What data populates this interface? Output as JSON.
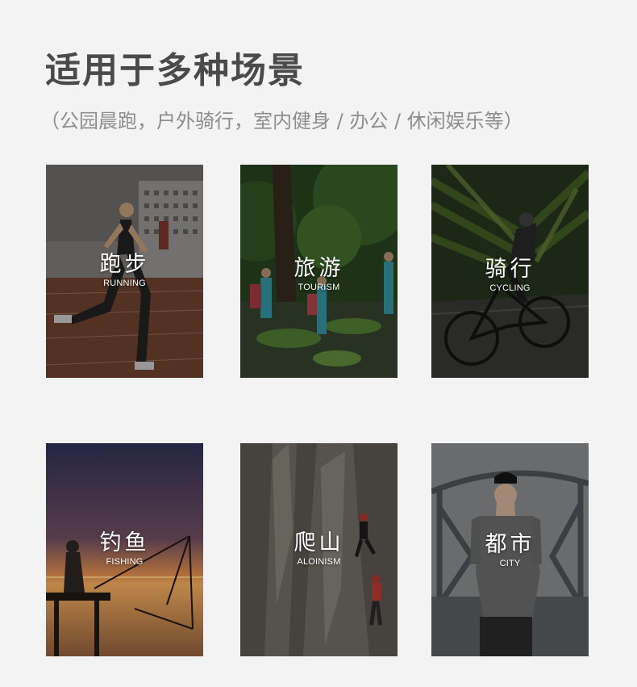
{
  "heading": {
    "title": "适用于多种场景",
    "subtitle": "（公园晨跑，户外骑行，室内健身 / 办公 / 休闲娱乐等）"
  },
  "scenes": [
    {
      "zh": "跑步",
      "en": "RUNNING"
    },
    {
      "zh": "旅游",
      "en": "TOURISM"
    },
    {
      "zh": "骑行",
      "en": "CYCLING"
    },
    {
      "zh": "钓鱼",
      "en": "FISHING"
    },
    {
      "zh": "爬山",
      "en": "ALOINISM"
    },
    {
      "zh": "都市",
      "en": "CITY"
    }
  ]
}
